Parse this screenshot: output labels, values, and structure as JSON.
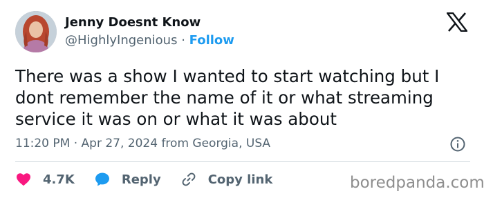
{
  "author": {
    "display_name": "Jenny Doesnt Know",
    "handle": "@HighlyIngenious",
    "separator": "·",
    "follow_label": "Follow"
  },
  "tweet": {
    "text": "There was a show I wanted to start watching but I dont remember the name of it or what streaming service it was on or what it was about",
    "timestamp": "11:20 PM · Apr 27, 2024 from Georgia, USA"
  },
  "actions": {
    "likes_count": "4.7K",
    "reply_label": "Reply",
    "copy_link_label": "Copy link"
  },
  "watermark": "boredpanda.com",
  "icons": {
    "logo": "x-logo-icon",
    "info": "info-icon",
    "like": "heart-icon",
    "reply": "reply-bubble-icon",
    "copy": "link-icon"
  },
  "colors": {
    "follow": "#1d9bf0",
    "heart": "#f91880",
    "reply_bubble": "#1d9bf0",
    "secondary_text": "#536471"
  }
}
